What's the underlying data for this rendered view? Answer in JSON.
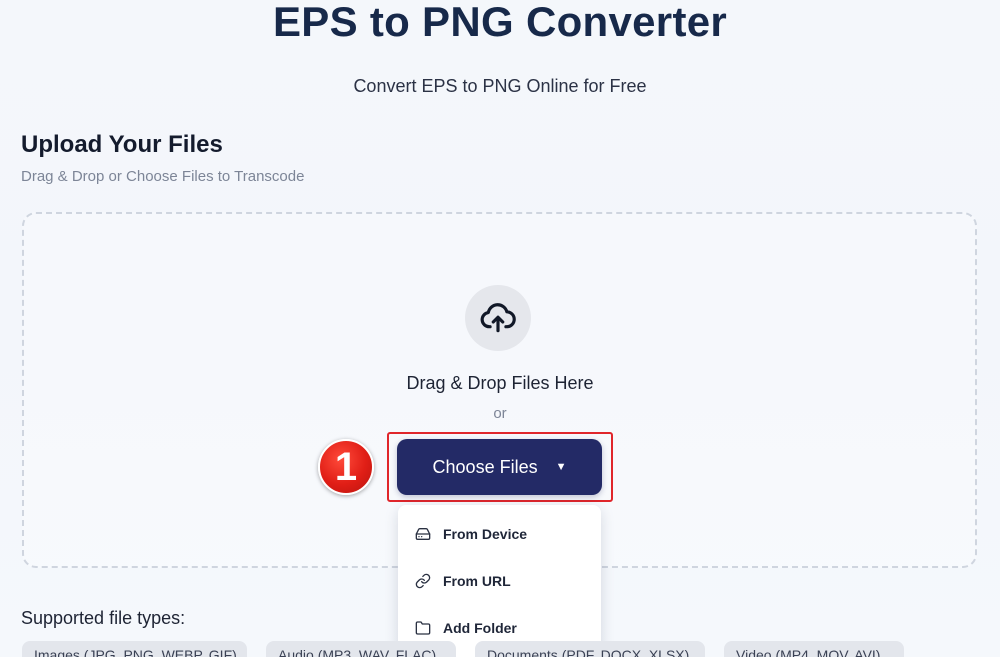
{
  "header": {
    "title": "EPS to PNG Converter",
    "subtitle": "Convert EPS to PNG Online for Free"
  },
  "upload": {
    "title": "Upload Your Files",
    "subtitle": "Drag & Drop or Choose Files to Transcode",
    "drop_text": "Drag & Drop Files Here",
    "or_text": "or",
    "choose_button_label": "Choose Files",
    "step_badge": "1"
  },
  "menu": {
    "items": [
      {
        "label": "From Device",
        "icon": "hard-drive-icon"
      },
      {
        "label": "From URL",
        "icon": "link-icon"
      },
      {
        "label": "Add Folder",
        "icon": "folder-icon"
      }
    ]
  },
  "supported": {
    "label": "Supported file types:",
    "chips": [
      "Images (JPG, PNG, WEBP, GIF)",
      "Audio (MP3, WAV, FLAC)",
      "Documents (PDF, DOCX, XLSX)",
      "Video (MP4, MOV, AVI)"
    ]
  },
  "colors": {
    "accent": "#232a66",
    "highlight": "#e0262b",
    "title": "#17294a"
  }
}
